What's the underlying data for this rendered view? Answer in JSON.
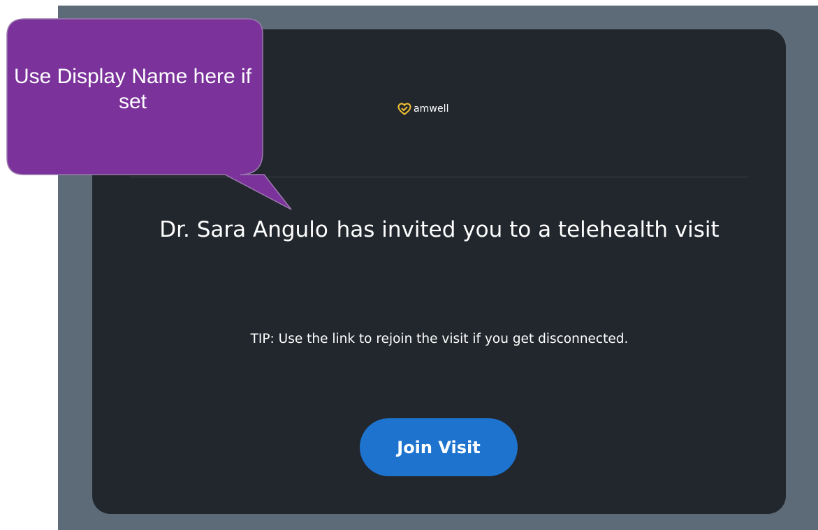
{
  "brand": {
    "logo_text": "amwell",
    "logo_icon": "heart-check-icon",
    "accent_color": "#f2c232"
  },
  "invite": {
    "provider_name": "Dr. Sara Angulo",
    "headline_rest": "has invited you to a telehealth visit",
    "tip": "TIP: Use the link to rejoin the visit if you get disconnected."
  },
  "actions": {
    "join_label": "Join Visit",
    "join_color": "#1e73cf"
  },
  "annotation": {
    "text": "Use Display Name here if set",
    "color": "#7b339b"
  },
  "colors": {
    "frame": "#5d6b79",
    "card": "#22272d"
  }
}
